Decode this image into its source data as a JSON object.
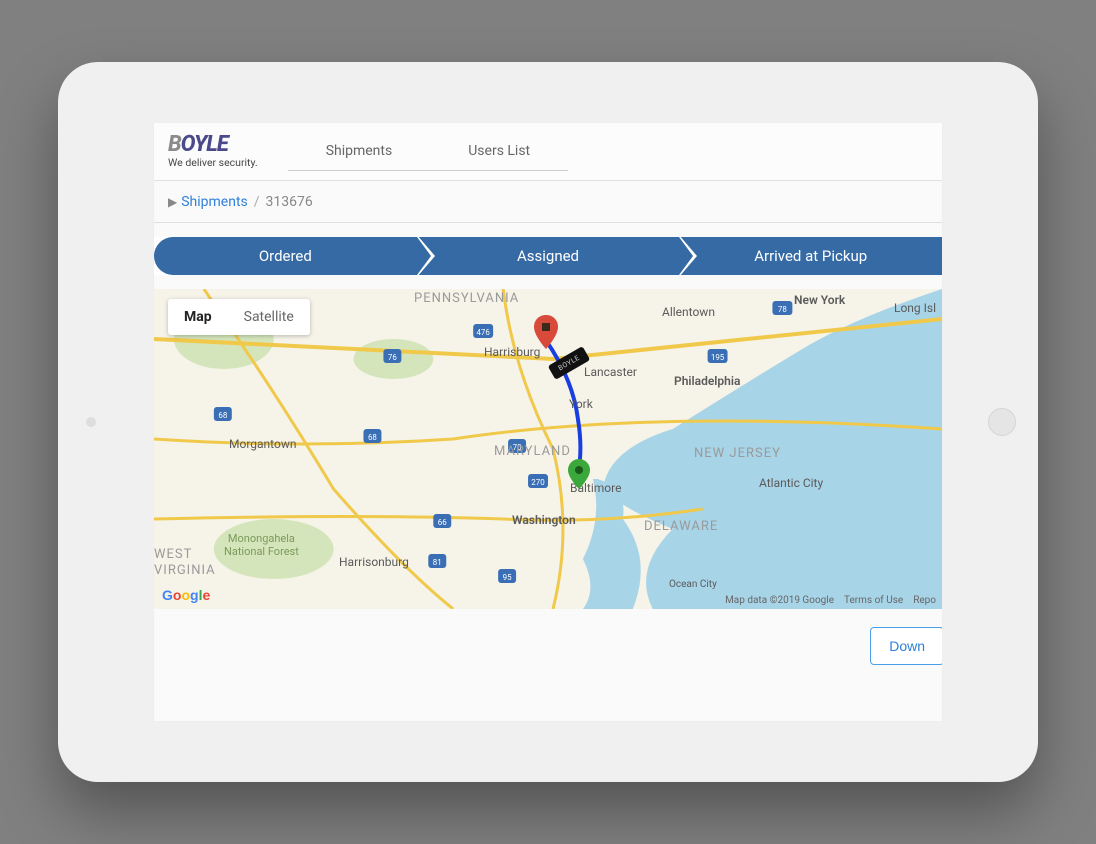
{
  "logo": {
    "name": "BOYLE",
    "tagline": "We deliver security."
  },
  "nav": {
    "shipments": "Shipments",
    "users_list": "Users List"
  },
  "breadcrumb": {
    "link": "Shipments",
    "separator": "/",
    "id": "313676"
  },
  "steps": {
    "ordered": "Ordered",
    "assigned": "Assigned",
    "arrived": "Arrived at Pickup"
  },
  "map": {
    "tabs": {
      "map": "Map",
      "satellite": "Satellite"
    },
    "cities": {
      "allentown": "Allentown",
      "new_york": "New York",
      "long_isl": "Long Isl",
      "harrisburg": "Harrisburg",
      "lancaster": "Lancaster",
      "philadelphia": "Philadelphia",
      "york": "York",
      "morgantown": "Morgantown",
      "baltimore": "Baltimore",
      "washington": "Washington",
      "atlantic_city": "Atlantic City",
      "harrisonburg": "Harrisonburg",
      "ocean_city": "Ocean City"
    },
    "states": {
      "pennsylvania": "PENNSYLVANIA",
      "maryland": "MARYLAND",
      "new_jersey": "NEW JERSEY",
      "delaware": "DELAWARE",
      "west_virginia_1": "WEST",
      "west_virginia_2": "VIRGINIA"
    },
    "forest": "Monongahela\nNational Forest",
    "truck_label": "BOYLE",
    "attribution": {
      "data": "Map data ©2019 Google",
      "terms": "Terms of Use",
      "report": "Repo"
    },
    "logo": "Google"
  },
  "actions": {
    "download": "Down"
  }
}
